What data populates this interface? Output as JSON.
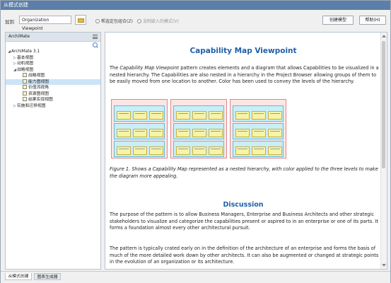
{
  "window": {
    "title": "从模式创建"
  },
  "toolbar": {
    "add_to_label": "加到",
    "package_value": "Organization Viewpoint",
    "radio_option_1": "帮选定包组合(Z)",
    "radio_option_2": "没制嵌入的模式(V)",
    "create_button": "创建模型",
    "help_button": "帮助(H)"
  },
  "tree": {
    "header": "ArchiMate",
    "root": "ArchiMate 3.1",
    "items": [
      {
        "label": "基本视图",
        "level": 1,
        "expander": "▷",
        "icon": false,
        "selected": false
      },
      {
        "label": "动机视图",
        "level": 1,
        "expander": "▷",
        "icon": false,
        "selected": false
      },
      {
        "label": "战略视图",
        "level": 1,
        "expander": "◢",
        "icon": false,
        "selected": false
      },
      {
        "label": "战略视图",
        "level": 2,
        "expander": "",
        "icon": true,
        "selected": false
      },
      {
        "label": "能力图视图",
        "level": 2,
        "expander": "",
        "icon": true,
        "selected": true
      },
      {
        "label": "价值流视角",
        "level": 2,
        "expander": "",
        "icon": true,
        "selected": false
      },
      {
        "label": "资源图视图",
        "level": 2,
        "expander": "",
        "icon": true,
        "selected": false
      },
      {
        "label": "结果实现视图",
        "level": 2,
        "expander": "",
        "icon": true,
        "selected": false
      },
      {
        "label": "实施和迁移视图",
        "level": 1,
        "expander": "▷",
        "icon": false,
        "selected": false
      }
    ]
  },
  "doc": {
    "title": "Capability Map Viewpoint",
    "intro_before": "The ",
    "intro_em": "Capability Map Viewpoint",
    "intro_after": " pattern creates elements and a diagram that allows Capabilities to be visualized in a nested hierarchy. The Capabilities are also nested in a hierarchy in the Project Browser allowing groups of them to be easily moved from one location to another. Color has been used to convey the levels of the hierarchy.",
    "figure_caption": "Figure 1. Shows a Capability Map represented as a nested hierarchy, with color applied to the three levels to make the diagram more appealing.",
    "section_title": "Discussion",
    "para_1": "The purpose of the pattern is to allow Business Managers,  Enterprise and Business Architects and other strategic stakeholders to visualize and categorize the capabilities present or aspired to in an enterprise or one of its parts. It forms a foundation almost every other architectural pursuit.",
    "para_2": "The pattern is typically crated early on in the definition of the architecture of an enterprise and forms the basis of much of the more detailed work down by other architects. It can also be augmented or changed at strategic points in the evolution of an organization or its architecture."
  },
  "tabs": {
    "tab_1": "从模式创建",
    "tab_2": "图表生成器"
  },
  "colors": {
    "title_blue": "#1f5fa8",
    "titlebar": "#5b7fa8",
    "selection": "#cce4f7"
  }
}
